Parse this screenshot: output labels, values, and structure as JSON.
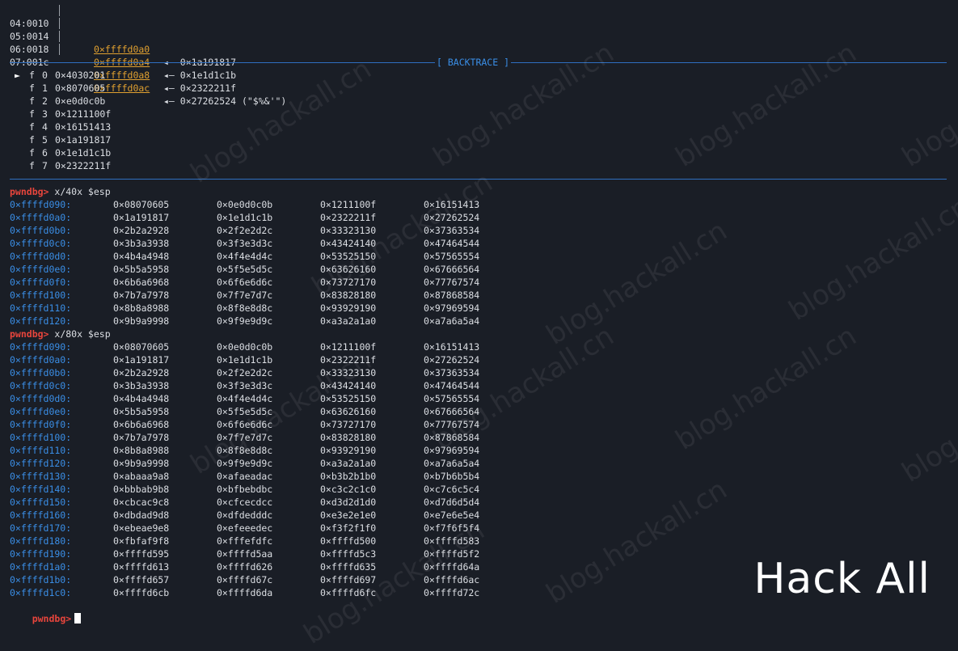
{
  "colors": {
    "background": "#1a1e26",
    "prompt": "#e8453c",
    "address": "#3a8ee6",
    "stack_address": "#e0a030",
    "separator": "#2f6fc0",
    "text": "#dcdfe4"
  },
  "stack": [
    {
      "idx": "04:0010",
      "addr": "0×ffffd0a0",
      "arrow": "◂—",
      "val": "0×1a191817"
    },
    {
      "idx": "05:0014",
      "addr": "0×ffffd0a4",
      "arrow": "◂—",
      "val": "0×1e1d1c1b"
    },
    {
      "idx": "06:0018",
      "addr": "0×ffffd0a8",
      "arrow": "◂—",
      "val": "0×2322211f"
    },
    {
      "idx": "07:001c",
      "addr": "0×ffffd0ac",
      "arrow": "◂—",
      "val": "0×27262524 (\"$%&'\")"
    }
  ],
  "backtrace": {
    "title": "[ BACKTRACE ]",
    "marker": "►",
    "frames": [
      {
        "f": "f",
        "n": "0",
        "addr": "0×4030201"
      },
      {
        "f": "f",
        "n": "1",
        "addr": "0×8070605"
      },
      {
        "f": "f",
        "n": "2",
        "addr": "0×e0d0c0b"
      },
      {
        "f": "f",
        "n": "3",
        "addr": "0×1211100f"
      },
      {
        "f": "f",
        "n": "4",
        "addr": "0×16151413"
      },
      {
        "f": "f",
        "n": "5",
        "addr": "0×1a191817"
      },
      {
        "f": "f",
        "n": "6",
        "addr": "0×1e1d1c1b"
      },
      {
        "f": "f",
        "n": "7",
        "addr": "0×2322211f"
      }
    ]
  },
  "commands": [
    {
      "prompt": "pwndbg>",
      "cmd": " x/40x $esp",
      "rows": [
        [
          "0×ffffd090:",
          "0×08070605",
          "0×0e0d0c0b",
          "0×1211100f",
          "0×16151413"
        ],
        [
          "0×ffffd0a0:",
          "0×1a191817",
          "0×1e1d1c1b",
          "0×2322211f",
          "0×27262524"
        ],
        [
          "0×ffffd0b0:",
          "0×2b2a2928",
          "0×2f2e2d2c",
          "0×33323130",
          "0×37363534"
        ],
        [
          "0×ffffd0c0:",
          "0×3b3a3938",
          "0×3f3e3d3c",
          "0×43424140",
          "0×47464544"
        ],
        [
          "0×ffffd0d0:",
          "0×4b4a4948",
          "0×4f4e4d4c",
          "0×53525150",
          "0×57565554"
        ],
        [
          "0×ffffd0e0:",
          "0×5b5a5958",
          "0×5f5e5d5c",
          "0×63626160",
          "0×67666564"
        ],
        [
          "0×ffffd0f0:",
          "0×6b6a6968",
          "0×6f6e6d6c",
          "0×73727170",
          "0×77767574"
        ],
        [
          "0×ffffd100:",
          "0×7b7a7978",
          "0×7f7e7d7c",
          "0×83828180",
          "0×87868584"
        ],
        [
          "0×ffffd110:",
          "0×8b8a8988",
          "0×8f8e8d8c",
          "0×93929190",
          "0×97969594"
        ],
        [
          "0×ffffd120:",
          "0×9b9a9998",
          "0×9f9e9d9c",
          "0×a3a2a1a0",
          "0×a7a6a5a4"
        ]
      ]
    },
    {
      "prompt": "pwndbg>",
      "cmd": " x/80x $esp",
      "rows": [
        [
          "0×ffffd090:",
          "0×08070605",
          "0×0e0d0c0b",
          "0×1211100f",
          "0×16151413"
        ],
        [
          "0×ffffd0a0:",
          "0×1a191817",
          "0×1e1d1c1b",
          "0×2322211f",
          "0×27262524"
        ],
        [
          "0×ffffd0b0:",
          "0×2b2a2928",
          "0×2f2e2d2c",
          "0×33323130",
          "0×37363534"
        ],
        [
          "0×ffffd0c0:",
          "0×3b3a3938",
          "0×3f3e3d3c",
          "0×43424140",
          "0×47464544"
        ],
        [
          "0×ffffd0d0:",
          "0×4b4a4948",
          "0×4f4e4d4c",
          "0×53525150",
          "0×57565554"
        ],
        [
          "0×ffffd0e0:",
          "0×5b5a5958",
          "0×5f5e5d5c",
          "0×63626160",
          "0×67666564"
        ],
        [
          "0×ffffd0f0:",
          "0×6b6a6968",
          "0×6f6e6d6c",
          "0×73727170",
          "0×77767574"
        ],
        [
          "0×ffffd100:",
          "0×7b7a7978",
          "0×7f7e7d7c",
          "0×83828180",
          "0×87868584"
        ],
        [
          "0×ffffd110:",
          "0×8b8a8988",
          "0×8f8e8d8c",
          "0×93929190",
          "0×97969594"
        ],
        [
          "0×ffffd120:",
          "0×9b9a9998",
          "0×9f9e9d9c",
          "0×a3a2a1a0",
          "0×a7a6a5a4"
        ],
        [
          "0×ffffd130:",
          "0×abaaa9a8",
          "0×afaeadac",
          "0×b3b2b1b0",
          "0×b7b6b5b4"
        ],
        [
          "0×ffffd140:",
          "0×bbbab9b8",
          "0×bfbebdbc",
          "0×c3c2c1c0",
          "0×c7c6c5c4"
        ],
        [
          "0×ffffd150:",
          "0×cbcac9c8",
          "0×cfcecdcc",
          "0×d3d2d1d0",
          "0×d7d6d5d4"
        ],
        [
          "0×ffffd160:",
          "0×dbdad9d8",
          "0×dfdedddc",
          "0×e3e2e1e0",
          "0×e7e6e5e4"
        ],
        [
          "0×ffffd170:",
          "0×ebeae9e8",
          "0×efeeedec",
          "0×f3f2f1f0",
          "0×f7f6f5f4"
        ],
        [
          "0×ffffd180:",
          "0×fbfaf9f8",
          "0×fffefdfc",
          "0×ffffd500",
          "0×ffffd583"
        ],
        [
          "0×ffffd190:",
          "0×ffffd595",
          "0×ffffd5aa",
          "0×ffffd5c3",
          "0×ffffd5f2"
        ],
        [
          "0×ffffd1a0:",
          "0×ffffd613",
          "0×ffffd626",
          "0×ffffd635",
          "0×ffffd64a"
        ],
        [
          "0×ffffd1b0:",
          "0×ffffd657",
          "0×ffffd67c",
          "0×ffffd697",
          "0×ffffd6ac"
        ],
        [
          "0×ffffd1c0:",
          "0×ffffd6cb",
          "0×ffffd6da",
          "0×ffffd6fc",
          "0×ffffd72c"
        ]
      ]
    }
  ],
  "final_prompt": "pwndbg>",
  "watermark": "Hack All",
  "ghost_watermark": "blog.hackall.cn"
}
